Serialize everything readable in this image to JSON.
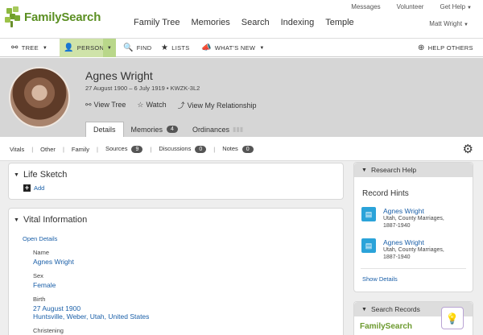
{
  "brand": {
    "logo_text": "FamilySearch"
  },
  "header": {
    "nav": [
      "Family Tree",
      "Memories",
      "Search",
      "Indexing",
      "Temple"
    ],
    "utility": [
      "Messages",
      "Volunteer",
      "Get Help"
    ],
    "user_name": "Matt Wright"
  },
  "toolbar": {
    "tree_label": "TREE",
    "person_label": "PERSON",
    "find_label": "FIND",
    "lists_label": "LISTS",
    "whats_new_label": "WHAT'S NEW",
    "help_others_label": "HELP OTHERS"
  },
  "person": {
    "name": "Agnes Wright",
    "dates": "27 August 1900 – 6 July 1919 • KWZK-3L2",
    "view_tree": "View Tree",
    "watch": "Watch",
    "view_relationship": "View My Relationship",
    "tabs": [
      {
        "label": "Details",
        "count": ""
      },
      {
        "label": "Memories",
        "count": "4"
      },
      {
        "label": "Ordinances",
        "count": ""
      }
    ]
  },
  "subnav": {
    "vitals": "Vitals",
    "other": "Other",
    "family": "Family",
    "sources": "Sources",
    "sources_count": "9",
    "discussions": "Discussions",
    "discussions_count": "0",
    "notes": "Notes",
    "notes_count": "0"
  },
  "life_sketch": {
    "title": "Life Sketch",
    "add_label": "Add"
  },
  "vital_info": {
    "title": "Vital Information",
    "open_details": "Open Details",
    "name_label": "Name",
    "name_value": "Agnes Wright",
    "sex_label": "Sex",
    "sex_value": "Female",
    "birth_label": "Birth",
    "birth_date": "27 August 1900",
    "birth_place": "Huntsville, Weber, Utah, United States",
    "christening_label": "Christening"
  },
  "research_help": {
    "title": "Research Help",
    "record_hints": "Record Hints",
    "hints": [
      {
        "name": "Agnes Wright",
        "sub1": "Utah, County Marriages,",
        "sub2": "1887-1940"
      },
      {
        "name": "Agnes Wright",
        "sub1": "Utah, County Marriages,",
        "sub2": "1887-1940"
      }
    ],
    "show_details": "Show Details"
  },
  "search_records": {
    "title": "Search Records"
  },
  "colors": {
    "brand_green": "#6c9a2e",
    "link_blue": "#1a5fa8",
    "hint_blue": "#2ba3d9"
  }
}
